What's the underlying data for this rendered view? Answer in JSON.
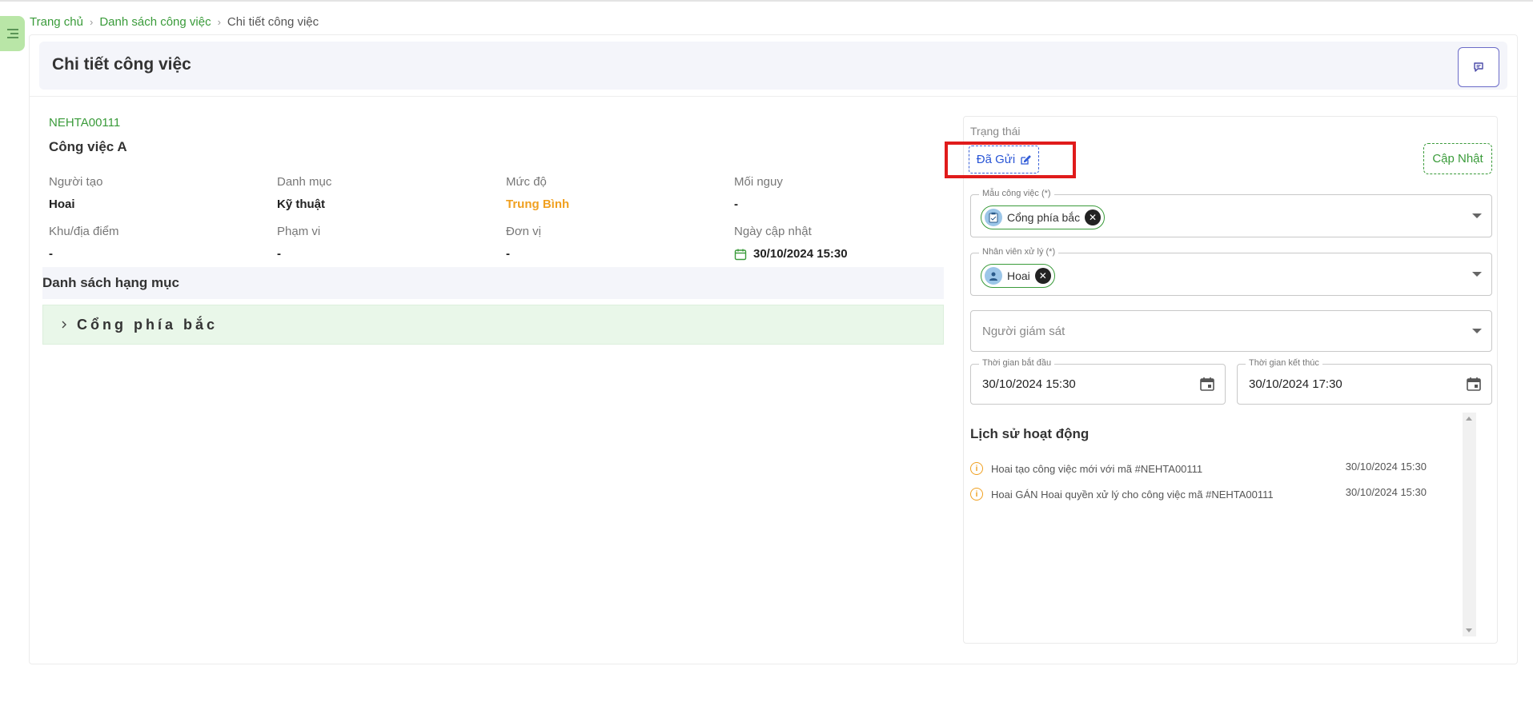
{
  "breadcrumb": {
    "home": "Trang chủ",
    "list": "Danh sách công việc",
    "current": "Chi tiết công việc"
  },
  "header": {
    "title": "Chi tiết công việc"
  },
  "task": {
    "code": "NEHTA00111",
    "name": "Công việc A",
    "fields": {
      "creator_label": "Người tạo",
      "creator_value": "Hoai",
      "category_label": "Danh mục",
      "category_value": "Kỹ thuật",
      "level_label": "Mức độ",
      "level_value": "Trung Bình",
      "risk_label": "Mối nguy",
      "risk_value": "-",
      "location_label": "Khu/địa điểm",
      "location_value": "-",
      "scope_label": "Phạm vi",
      "scope_value": "-",
      "unit_label": "Đơn vị",
      "unit_value": "-",
      "updated_label": "Ngày cập nhật",
      "updated_value": "30/10/2024 15:30"
    }
  },
  "items_section": {
    "title": "Danh sách hạng mục",
    "items": [
      "Cổng phía bắc"
    ]
  },
  "status_panel": {
    "status_label": "Trạng thái",
    "status_value": "Đã Gửi",
    "update_button": "Cập Nhật",
    "template_label": "Mẫu công việc (*)",
    "template_chip": "Cổng phía bắc",
    "assignee_label": "Nhân viên xử lý (*)",
    "assignee_chip": "Hoai",
    "supervisor_placeholder": "Người giám sát",
    "start_label": "Thời gian bắt đầu",
    "start_value": "30/10/2024 15:30",
    "end_label": "Thời gian kết thúc",
    "end_value": "30/10/2024 17:30"
  },
  "history": {
    "title": "Lịch sử hoạt động",
    "entries": [
      {
        "text": "Hoai tạo công việc mới với mã #NEHTA00111",
        "time": "30/10/2024 15:30"
      },
      {
        "text": "Hoai GÁN Hoai quyền xử lý cho công việc mã #NEHTA00111",
        "time": "30/10/2024 15:30"
      }
    ]
  },
  "colors": {
    "accent_green": "#3a9b3a",
    "status_blue": "#2a56d6",
    "level_orange": "#f0a020",
    "highlight_red": "#e01b1b"
  },
  "icons": {
    "menu": "menu-lines-icon",
    "chat": "chat-icon",
    "edit": "edit-icon",
    "calendar": "calendar-icon",
    "info": "info-icon",
    "chevron": "chevron-right-icon"
  }
}
